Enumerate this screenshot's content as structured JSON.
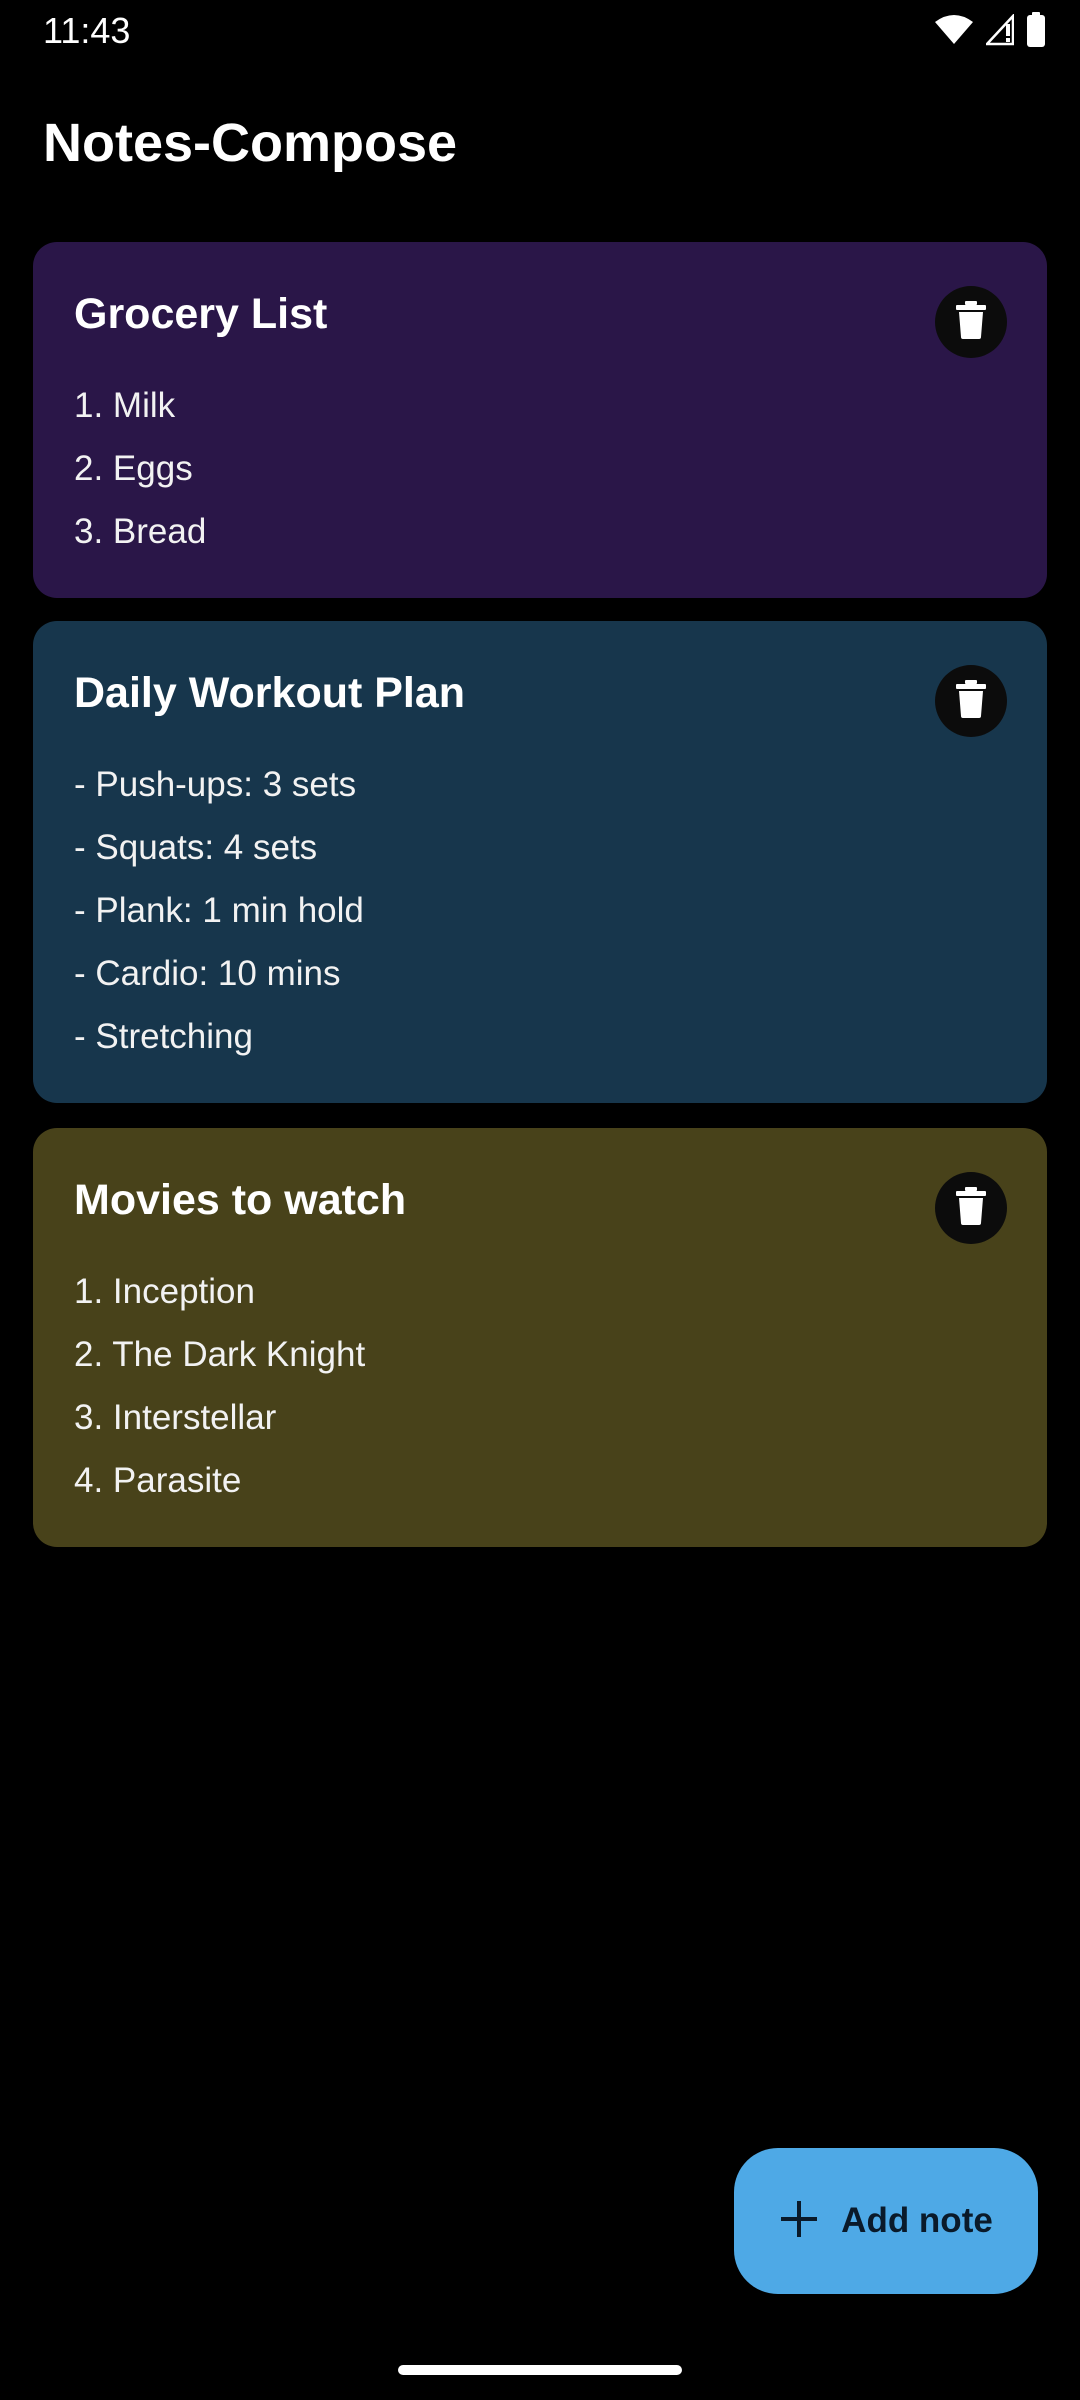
{
  "status_bar": {
    "time": "11:43",
    "icons": [
      "wifi-icon",
      "signal-icon",
      "battery-icon"
    ]
  },
  "app": {
    "title": "Notes-Compose"
  },
  "notes": [
    {
      "title": "Grocery List",
      "lines": [
        "1. Milk",
        "2. Eggs",
        "3. Bread"
      ],
      "color": "#2a1648",
      "delete_icon": "trash-icon"
    },
    {
      "title": "Daily Workout Plan",
      "lines": [
        "- Push-ups: 3 sets",
        "- Squats: 4 sets",
        "- Plank: 1 min hold",
        "- Cardio: 10 mins",
        "- Stretching"
      ],
      "color": "#17364c",
      "delete_icon": "trash-icon"
    },
    {
      "title": "Movies to watch",
      "lines": [
        "1. Inception",
        "2. The Dark Knight",
        "3. Interstellar",
        "4. Parasite"
      ],
      "color": "#48421a",
      "delete_icon": "trash-icon"
    }
  ],
  "fab": {
    "label": "Add note",
    "icon": "plus-icon",
    "color": "#4ea9e6"
  },
  "colors": {
    "background": "#000000",
    "delete_button_bg": "#0c0c0c"
  }
}
